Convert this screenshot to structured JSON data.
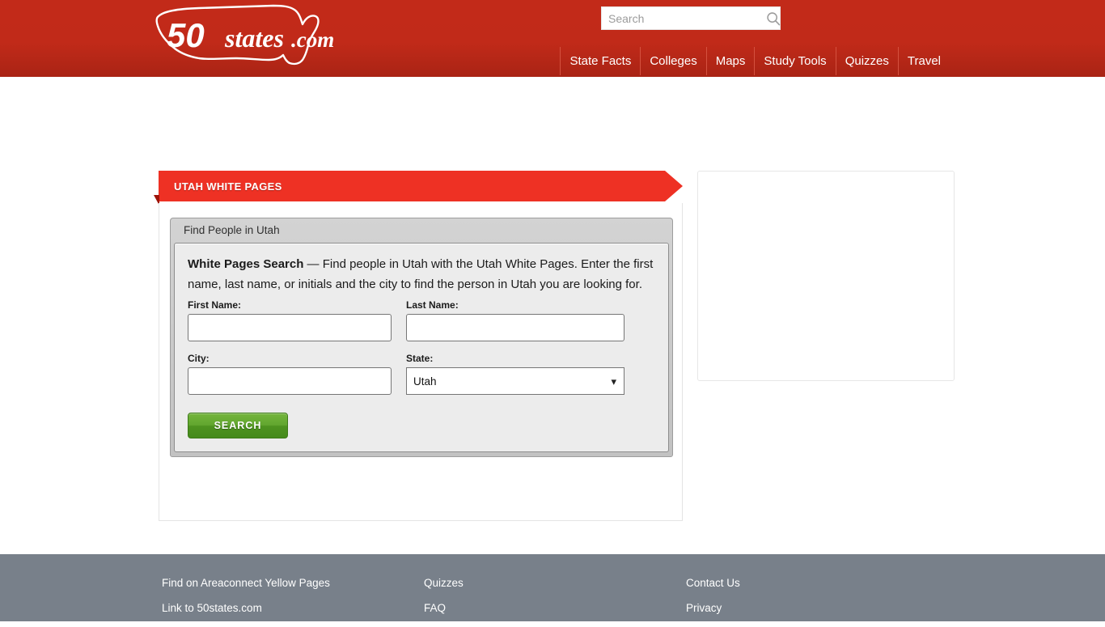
{
  "header": {
    "logo_text_50": "50",
    "logo_text_states": "states",
    "logo_text_com": ".com",
    "logo_alt": "50states.com",
    "search": {
      "placeholder": "Search",
      "value": "",
      "icon": "search-icon"
    },
    "nav": [
      {
        "label": "State Facts"
      },
      {
        "label": "Colleges"
      },
      {
        "label": "Maps"
      },
      {
        "label": "Study Tools"
      },
      {
        "label": "Quizzes"
      },
      {
        "label": "Travel"
      }
    ],
    "colors": {
      "header_red_top": "#c22a19",
      "header_red_bottom": "#a92314",
      "nav_divider": "#d4513f"
    }
  },
  "main": {
    "ribbon_title": "UTAH WHITE PAGES",
    "ribbon_color": "#ee3124",
    "widget_title": "Find People in Utah",
    "intro": {
      "lead": "White Pages Search",
      "body": " — Find people in Utah with the Utah White Pages. Enter the first name, last name, or initials and the city to find the person in Utah you are looking for."
    },
    "form": {
      "first_name": {
        "label": "First Name:",
        "value": "",
        "placeholder": ""
      },
      "last_name": {
        "label": "Last Name:",
        "value": "",
        "placeholder": ""
      },
      "city": {
        "label": "City:",
        "value": "",
        "placeholder": ""
      },
      "state": {
        "label": "State:",
        "selected": "Utah",
        "options": [
          "Utah"
        ],
        "caret_icon": "chevron-down-icon"
      },
      "submit_label": "SEARCH",
      "submit_color": "#62a62f"
    }
  },
  "sidebar": {
    "placeholder_label": ""
  },
  "footer": {
    "background": "#78808a",
    "columns": [
      {
        "links": [
          {
            "label": "Find on Areaconnect Yellow Pages"
          },
          {
            "label": "Link to 50states.com"
          }
        ]
      },
      {
        "links": [
          {
            "label": "Quizzes"
          },
          {
            "label": "FAQ"
          }
        ]
      },
      {
        "links": [
          {
            "label": "Contact Us"
          },
          {
            "label": "Privacy"
          }
        ]
      }
    ]
  }
}
